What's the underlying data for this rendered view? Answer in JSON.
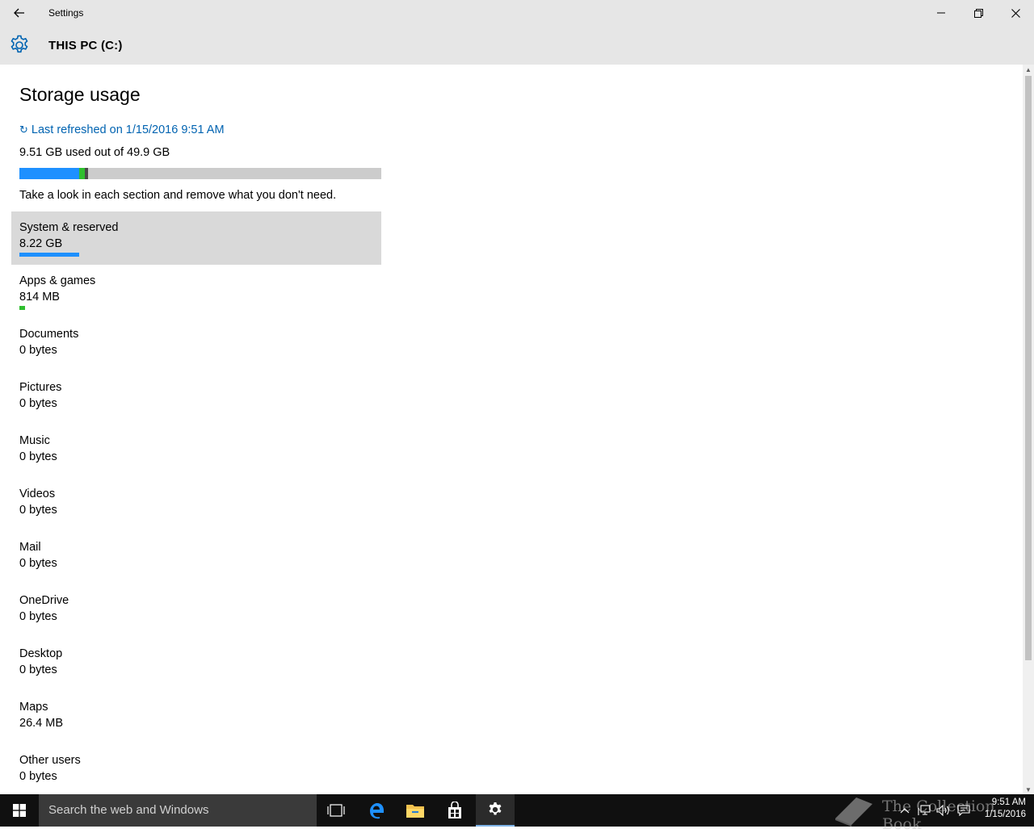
{
  "window": {
    "app_title": "Settings",
    "back_icon": "back-arrow-icon",
    "minimize_icon": "minimize-icon",
    "maximize_icon": "restore-icon",
    "close_icon": "close-icon"
  },
  "header": {
    "title": "THIS PC (C:)",
    "icon": "gear-icon",
    "accent": "#0063b1"
  },
  "storage": {
    "heading": "Storage usage",
    "refresh_label": "Last refreshed on 1/15/2016 9:51 AM",
    "usage_summary": "9.51 GB used out of 49.9 GB",
    "used_gb": 9.51,
    "total_gb": 49.9,
    "hint": "Take a look in each section and remove what you don't need.",
    "bar_segments": [
      {
        "name": "System & reserved",
        "gb": 8.22,
        "color": "#1e90ff"
      },
      {
        "name": "Apps & games",
        "gb": 0.814,
        "color": "#2fbf2f"
      },
      {
        "name": "Other",
        "gb": 0.47,
        "color": "#4a4a4a"
      }
    ],
    "bar_background": "#cccccc"
  },
  "categories": [
    {
      "name": "System & reserved",
      "size": "8.22 GB",
      "fraction": 0.165,
      "color": "#1e90ff",
      "selected": true
    },
    {
      "name": "Apps & games",
      "size": "814 MB",
      "fraction": 0.0163,
      "color": "#2fbf2f",
      "selected": false
    },
    {
      "name": "Documents",
      "size": "0 bytes",
      "fraction": 0,
      "color": "#1e90ff",
      "selected": false
    },
    {
      "name": "Pictures",
      "size": "0 bytes",
      "fraction": 0,
      "color": "#1e90ff",
      "selected": false
    },
    {
      "name": "Music",
      "size": "0 bytes",
      "fraction": 0,
      "color": "#1e90ff",
      "selected": false
    },
    {
      "name": "Videos",
      "size": "0 bytes",
      "fraction": 0,
      "color": "#1e90ff",
      "selected": false
    },
    {
      "name": "Mail",
      "size": "0 bytes",
      "fraction": 0,
      "color": "#1e90ff",
      "selected": false
    },
    {
      "name": "OneDrive",
      "size": "0 bytes",
      "fraction": 0,
      "color": "#1e90ff",
      "selected": false
    },
    {
      "name": "Desktop",
      "size": "0 bytes",
      "fraction": 0,
      "color": "#1e90ff",
      "selected": false
    },
    {
      "name": "Maps",
      "size": "26.4 MB",
      "fraction": 0,
      "color": "#1e90ff",
      "selected": false
    },
    {
      "name": "Other users",
      "size": "0 bytes",
      "fraction": 0,
      "color": "#1e90ff",
      "selected": false
    }
  ],
  "taskbar": {
    "search_placeholder": "Search the web and Windows",
    "watermark": "The Collection Book",
    "clock_time": "9:51 AM",
    "clock_date": "1/15/2016",
    "icons": [
      "windows-start-icon",
      "task-view-icon",
      "edge-icon",
      "file-explorer-icon",
      "store-icon",
      "settings-gear-icon"
    ]
  }
}
